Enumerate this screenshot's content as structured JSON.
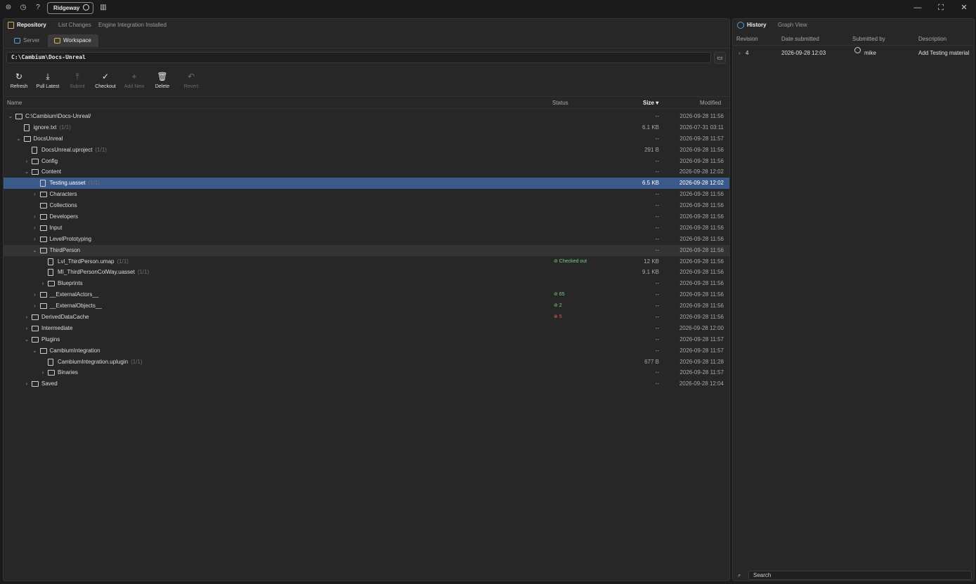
{
  "titlebar": {
    "workspace_pill": "Ridgeway",
    "icons": [
      "help-circle-icon",
      "history-icon",
      "question-icon",
      "layout-icon"
    ]
  },
  "left": {
    "tabs": [
      {
        "label": "Repository",
        "active": true
      },
      {
        "label": "List Changes",
        "active": false
      },
      {
        "label": "Engine Integration Installed",
        "active": false
      }
    ],
    "subtabs": [
      {
        "label": "Server",
        "active": false
      },
      {
        "label": "Workspace",
        "active": true
      }
    ],
    "path": "C:\\Cambium\\Docs-Unreal",
    "toolbar": [
      {
        "label": "Refresh",
        "icon": "refresh-icon",
        "enabled": true
      },
      {
        "label": "Pull Latest",
        "icon": "download-icon",
        "enabled": true
      },
      {
        "label": "Submit",
        "icon": "upload-icon",
        "enabled": false
      },
      {
        "label": "Checkout",
        "icon": "check-icon",
        "enabled": true
      },
      {
        "label": "Add New",
        "icon": "plus-icon",
        "enabled": false
      },
      {
        "label": "Delete",
        "icon": "trash-icon",
        "enabled": true
      },
      {
        "label": "Revert",
        "icon": "undo-icon",
        "enabled": false
      }
    ],
    "columns": {
      "name": "Name",
      "status": "Status",
      "size": "Size ▾",
      "modified": "Modified"
    },
    "rows": [
      {
        "name": "C:\\Cambium\\Docs-Unreal/",
        "type": "folder",
        "depth": 0,
        "expand": "open",
        "count": "",
        "status": "",
        "size": "--",
        "modified": "2026-09-28 11:56"
      },
      {
        "name": "ignore.txt",
        "type": "file",
        "depth": 1,
        "expand": "",
        "count": "(1/1)",
        "status": "",
        "size": "6.1 KB",
        "modified": "2026-07-31 03:11"
      },
      {
        "name": "DocsUnreal",
        "type": "folder",
        "depth": 1,
        "expand": "open",
        "count": "",
        "status": "",
        "size": "--",
        "modified": "2026-09-28 11:57"
      },
      {
        "name": "DocsUnreal.uproject",
        "type": "file",
        "depth": 2,
        "expand": "",
        "count": "(1/1)",
        "status": "",
        "size": "291 B",
        "modified": "2026-09-28 11:56"
      },
      {
        "name": "Config",
        "type": "folder",
        "depth": 2,
        "expand": "closed",
        "count": "",
        "status": "",
        "size": "--",
        "modified": "2026-09-28 11:56"
      },
      {
        "name": "Content",
        "type": "folder",
        "depth": 2,
        "expand": "open",
        "count": "",
        "status": "",
        "size": "--",
        "modified": "2026-09-28 12:02"
      },
      {
        "name": "Testing.uasset",
        "type": "file",
        "depth": 3,
        "expand": "",
        "count": "(1/1)",
        "status": "",
        "size": "6.5 KB",
        "modified": "2026-09-28 12:02",
        "selected": true
      },
      {
        "name": "Characters",
        "type": "folder",
        "depth": 3,
        "expand": "closed",
        "count": "",
        "status": "",
        "size": "--",
        "modified": "2026-09-28 11:56"
      },
      {
        "name": "Collections",
        "type": "folder",
        "depth": 3,
        "expand": "",
        "count": "",
        "status": "",
        "size": "--",
        "modified": "2026-09-28 11:56"
      },
      {
        "name": "Developers",
        "type": "folder",
        "depth": 3,
        "expand": "closed",
        "count": "",
        "status": "",
        "size": "--",
        "modified": "2026-09-28 11:56"
      },
      {
        "name": "Input",
        "type": "folder",
        "depth": 3,
        "expand": "closed",
        "count": "",
        "status": "",
        "size": "--",
        "modified": "2026-09-28 11:56"
      },
      {
        "name": "LevelPrototyping",
        "type": "folder",
        "depth": 3,
        "expand": "closed",
        "count": "",
        "status": "",
        "size": "--",
        "modified": "2026-09-28 11:56"
      },
      {
        "name": "ThirdPerson",
        "type": "folder",
        "depth": 3,
        "expand": "open",
        "count": "",
        "status": "",
        "size": "--",
        "modified": "2026-09-28 11:56",
        "hover": true
      },
      {
        "name": "Lvl_ThirdPerson.umap",
        "type": "file",
        "depth": 4,
        "expand": "",
        "count": "(1/1)",
        "status": "⊘ Checked out",
        "status_color": "green",
        "size": "12 KB",
        "modified": "2026-09-28 11:56"
      },
      {
        "name": "MI_ThirdPersonColWay.uasset",
        "type": "file",
        "depth": 4,
        "expand": "",
        "count": "(1/1)",
        "status": "",
        "size": "9.1 KB",
        "modified": "2026-09-28 11:56"
      },
      {
        "name": "Blueprints",
        "type": "folder",
        "depth": 4,
        "expand": "closed",
        "count": "",
        "status": "",
        "size": "--",
        "modified": "2026-09-28 11:56"
      },
      {
        "name": "__ExternalActors__",
        "type": "folder",
        "depth": 3,
        "expand": "closed",
        "count": "",
        "status": "⊘ 65",
        "status_color": "green",
        "size": "--",
        "modified": "2026-09-28 11:56"
      },
      {
        "name": "__ExternalObjects__",
        "type": "folder",
        "depth": 3,
        "expand": "closed",
        "count": "",
        "status": "⊘ 2",
        "status_color": "green",
        "size": "--",
        "modified": "2026-09-28 11:56"
      },
      {
        "name": "DerivedDataCache",
        "type": "folder",
        "depth": 2,
        "expand": "closed",
        "count": "",
        "status": "⊗ 5",
        "status_color": "red",
        "size": "--",
        "modified": "2026-09-28 11:56"
      },
      {
        "name": "Intermediate",
        "type": "folder",
        "depth": 2,
        "expand": "closed",
        "count": "",
        "status": "",
        "size": "--",
        "modified": "2026-09-28 12:00"
      },
      {
        "name": "Plugins",
        "type": "folder",
        "depth": 2,
        "expand": "open",
        "count": "",
        "status": "",
        "size": "--",
        "modified": "2026-09-28 11:57"
      },
      {
        "name": "CambiumIntegration",
        "type": "folder",
        "depth": 3,
        "expand": "open",
        "count": "",
        "status": "",
        "size": "--",
        "modified": "2026-09-28 11:57"
      },
      {
        "name": "CambiumIntegration.uplugin",
        "type": "file",
        "depth": 4,
        "expand": "",
        "count": "(1/1)",
        "status": "",
        "size": "677 B",
        "modified": "2026-09-28 11:28"
      },
      {
        "name": "Binaries",
        "type": "folder",
        "depth": 4,
        "expand": "closed",
        "count": "",
        "status": "",
        "size": "--",
        "modified": "2026-09-28 11:57"
      },
      {
        "name": "Saved",
        "type": "folder",
        "depth": 2,
        "expand": "closed",
        "count": "",
        "status": "",
        "size": "--",
        "modified": "2026-09-28 12:04"
      }
    ]
  },
  "right": {
    "tabs": [
      {
        "label": "History",
        "active": true
      },
      {
        "label": "Graph View",
        "active": false
      }
    ],
    "columns": {
      "revision": "Revision",
      "date": "Date submitted",
      "by": "Submitted by",
      "desc": "Description"
    },
    "rows": [
      {
        "revision": "4",
        "date": "2026-09-28 12:03",
        "by": "mike",
        "desc": "Add Testing material"
      }
    ],
    "search_placeholder": "Search"
  },
  "colors": {
    "accent_selected": "#3a5a8c",
    "status_green": "#7ccf86",
    "status_red": "#e05555",
    "repo_icon": "#d6b25a",
    "history_icon": "#4aa3d8"
  }
}
